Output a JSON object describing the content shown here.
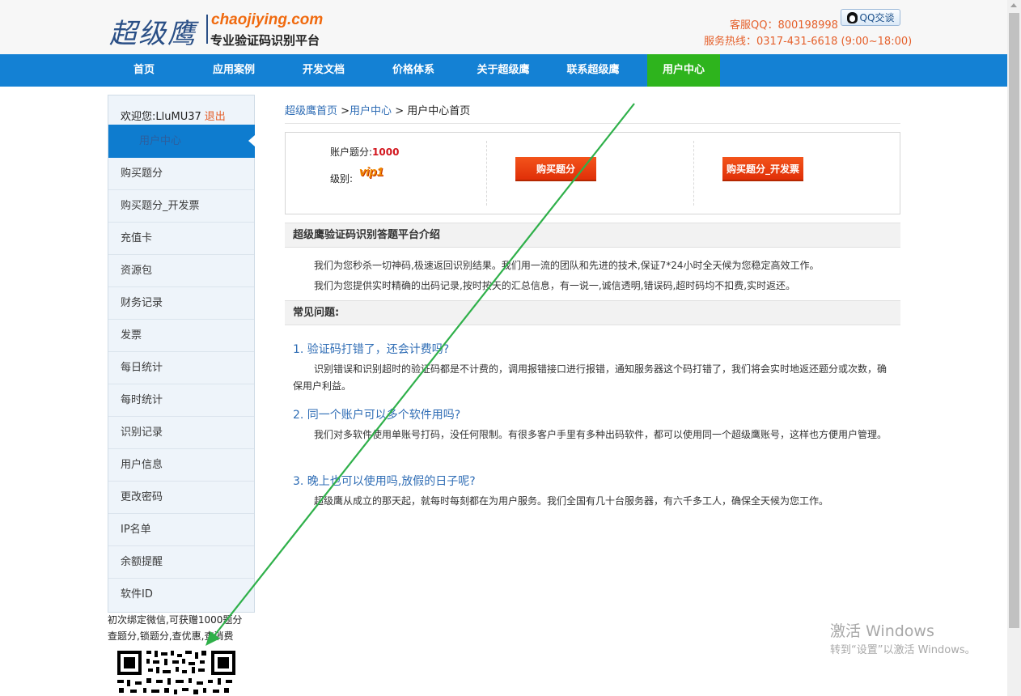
{
  "header": {
    "logo_cn": "超级鹰",
    "logo_en": "chaojiying.com",
    "logo_sub": "专业验证码识别平台",
    "qq_label": "客服QQ：800198998",
    "qq_button": "QQ交谈",
    "hotline": "服务热线：0317-431-6618 (9:00~18:00)"
  },
  "nav": {
    "items": [
      "首页",
      "应用案例",
      "开发文档",
      "价格体系",
      "关于超级鹰",
      "联系超级鹰",
      "用户中心"
    ],
    "active_index": 6
  },
  "sidebar": {
    "welcome": "欢迎您:LluMU37",
    "logout": "退出",
    "active_item": "用户中心",
    "items": [
      "购买题分",
      "购买题分_开发票",
      "充值卡",
      "资源包",
      "财务记录",
      "发票",
      "每日统计",
      "每时统计",
      "识别记录",
      "用户信息",
      "更改密码",
      "IP名单",
      "余额提醒",
      "软件ID"
    ],
    "wechat_line1": "初次绑定微信,可获赠1000题分",
    "wechat_line2": "查题分,锁题分,查优惠,查消费"
  },
  "breadcrumb": {
    "home": "超级鹰首页",
    "sep1": " >",
    "user_center": "用户中心",
    "sep2": " > ",
    "current": "用户中心首页"
  },
  "account": {
    "score_label": "账户题分:",
    "score_value": "1000",
    "level_label": "级别:",
    "level_badge": "vip1",
    "buy_button": "购买题分",
    "buy_invoice_button": "购买题分_开发票"
  },
  "intro": {
    "title": "超级鹰验证码识别答题平台介绍",
    "p1": "我们为您秒杀一切神码,极速返回识别结果。我们用一流的团队和先进的技术,保证7*24小时全天候为您稳定高效工作。",
    "p2": "我们为您提供实时精确的出码记录,按时按天的汇总信息，有一说一,诚信透明,错误码,超时码均不扣费,实时返还。"
  },
  "faq": {
    "title": "常见问题:",
    "items": [
      {
        "q": "1. 验证码打错了，还会计费吗?",
        "a": "识别错误和识别超时的验证码都是不计费的，调用报错接口进行报错，通知服务器这个码打错了，我们将会实时地返还题分或次数，确保用户利益。"
      },
      {
        "q": "2. 同一个账户可以多个软件用吗?",
        "a": "我们对多软件使用单账号打码，没任何限制。有很多客户手里有多种出码软件，都可以使用同一个超级鹰账号，这样也方便用户管理。"
      },
      {
        "q": "3. 晚上也可以使用吗,放假的日子呢?",
        "a": "超级鹰从成立的那天起，就每时每刻都在为用户服务。我们全国有几十台服务器，有六千多工人，确保全天候为您工作。"
      }
    ]
  },
  "watermark": {
    "title": "激活 Windows",
    "subtitle": "转到“设置”以激活 Windows。"
  },
  "colors": {
    "nav_blue": "#1481d4",
    "nav_active_green": "#2eb41d",
    "accent_orange": "#e5602b",
    "link_blue": "#2f6db5",
    "button_red": "#e94315",
    "annotation_green": "#2fb04a"
  }
}
